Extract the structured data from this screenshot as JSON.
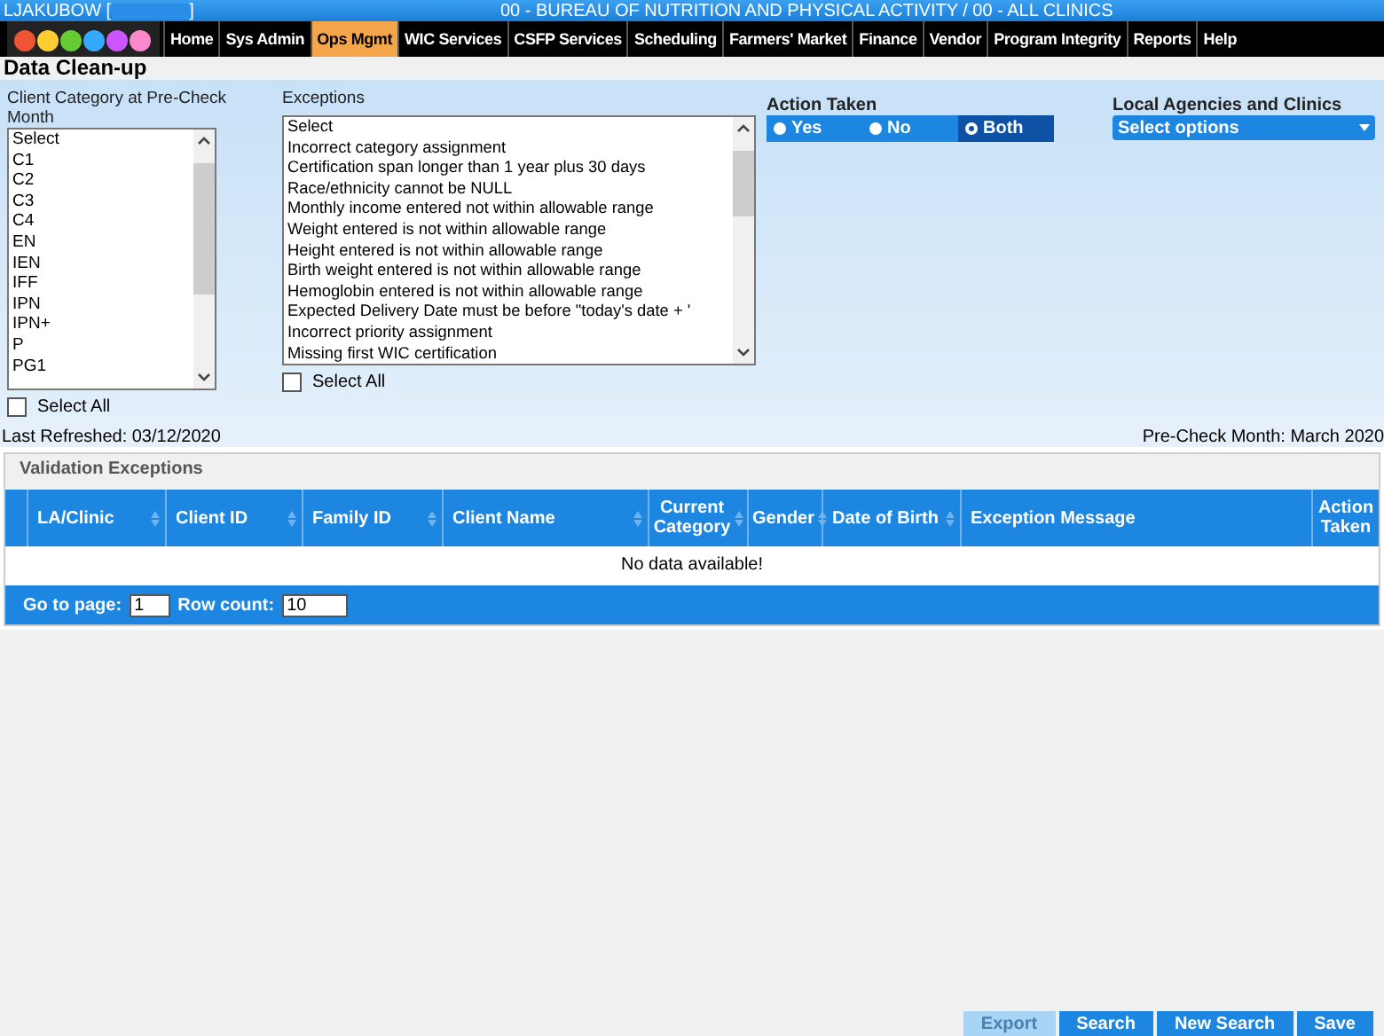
{
  "header": {
    "user": "LJAKUBOW [",
    "user_end": "]",
    "agency": "00 - BUREAU OF NUTRITION AND PHYSICAL ACTIVITY / 00 - ALL CLINICS"
  },
  "nav": [
    {
      "label": "Home",
      "selected": false
    },
    {
      "label": "Sys Admin",
      "selected": false
    },
    {
      "label": "Ops Mgmt",
      "selected": true
    },
    {
      "label": "WIC Services",
      "selected": false
    },
    {
      "label": "CSFP Services",
      "selected": false
    },
    {
      "label": "Scheduling",
      "selected": false
    },
    {
      "label": "Farmers' Market",
      "selected": false
    },
    {
      "label": "Finance",
      "selected": false
    },
    {
      "label": "Vendor",
      "selected": false
    },
    {
      "label": "Program Integrity",
      "selected": false
    },
    {
      "label": "Reports",
      "selected": false
    },
    {
      "label": "Help",
      "selected": false
    }
  ],
  "page_title": "Data Clean-up",
  "filters": {
    "client_category": {
      "label": "Client Category at Pre-Check Month",
      "options": [
        "Select",
        "C1",
        "C2",
        "C3",
        "C4",
        "EN",
        "IEN",
        "IFF",
        "IPN",
        "IPN+",
        "P",
        "PG1"
      ],
      "select_all": {
        "label": "Select All",
        "checked": false
      }
    },
    "exceptions": {
      "label": "Exceptions",
      "options": [
        "Select",
        "Incorrect category assignment",
        "Certification span longer than 1 year plus 30 days",
        "Race/ethnicity cannot be NULL",
        "Monthly income entered not within allowable range",
        "Weight entered is not within allowable range",
        "Height entered is not within allowable range",
        "Birth weight entered is not within allowable range",
        "Hemoglobin entered is not within allowable range",
        "Expected Delivery Date must be before \"today's date + '",
        "Incorrect priority assignment",
        "Missing first WIC certification"
      ],
      "select_all": {
        "label": "Select All",
        "checked": false
      }
    },
    "action_taken": {
      "label": "Action Taken",
      "options": [
        {
          "label": "Yes",
          "selected": false
        },
        {
          "label": "No",
          "selected": false
        },
        {
          "label": "Both",
          "selected": true
        }
      ]
    },
    "local_agencies": {
      "label": "Local Agencies and Clinics",
      "placeholder": "Select options"
    }
  },
  "last_refreshed": "Last Refreshed: 03/12/2020",
  "pre_check_month": "Pre-Check Month: March 2020",
  "grid": {
    "title": "Validation Exceptions",
    "columns": [
      "LA/Clinic",
      "Client ID",
      "Family ID",
      "Client Name",
      "Current Category",
      "Gender",
      "Date of Birth",
      "Exception Message",
      "Action Taken"
    ],
    "empty_message": "No data available!",
    "pager": {
      "page_label": "Go to page:",
      "page": "1",
      "row_count_label": "Row count:",
      "row_count": "10"
    }
  },
  "buttons": [
    {
      "label": "Export",
      "disabled": true
    },
    {
      "label": "Search",
      "disabled": false
    },
    {
      "label": "New Search",
      "disabled": false
    },
    {
      "label": "Save",
      "disabled": false
    }
  ]
}
